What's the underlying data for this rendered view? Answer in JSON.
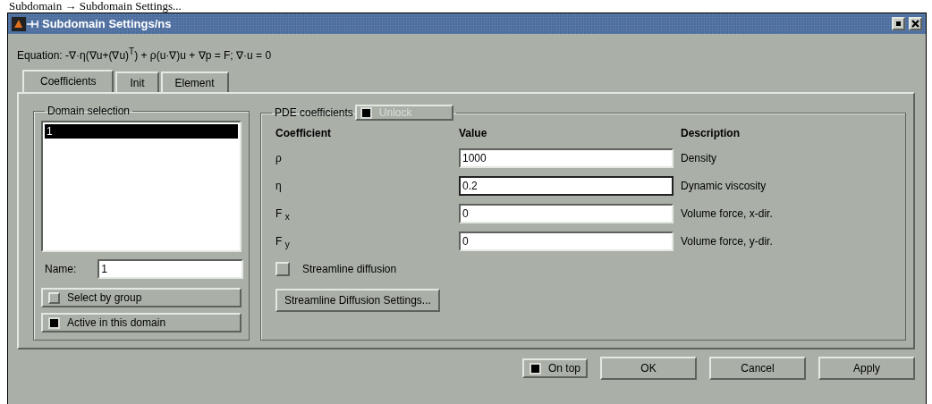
{
  "caption": "Subdomain → Subdomain Settings...",
  "window": {
    "title": "Subdomain Settings/ns"
  },
  "equation": "Equation: -∇·η(∇u+(∇u)$^{T}$) + ρ(u·∇)u + ∇p = F; ∇·u = 0",
  "tabs": [
    {
      "label": "Coefficients",
      "selected": true
    },
    {
      "label": "Init",
      "selected": false
    },
    {
      "label": "Element",
      "selected": false
    }
  ],
  "domain_selection": {
    "title": "Domain selection",
    "items": [
      {
        "label": "1",
        "selected": true
      }
    ],
    "name_label": "Name:",
    "name_value": "1",
    "toggles": [
      {
        "label": "Select by group",
        "checked": false
      },
      {
        "label": "Active in this domain",
        "checked": true
      }
    ]
  },
  "pde": {
    "title": "PDE coefficients",
    "unlock": {
      "label": "Unlock",
      "checked": true,
      "disabled": true
    },
    "columns": [
      "Coefficient",
      "Value",
      "Description"
    ],
    "rows": [
      {
        "coefficient": "ρ",
        "value": "1000",
        "description": "Density",
        "focused": false
      },
      {
        "coefficient": "η",
        "value": "0.2",
        "description": "Dynamic viscosity",
        "focused": true
      },
      {
        "coefficient": "F $_{x}$",
        "value": "0",
        "description": "Volume force, x-dir.",
        "focused": false
      },
      {
        "coefficient": "F $_{y}$",
        "value": "0",
        "description": "Volume force, y-dir.",
        "focused": false
      }
    ],
    "streamline": {
      "label": "Streamline diffusion",
      "checked": false
    },
    "settings_button": "Streamline Diffusion Settings..."
  },
  "footer": {
    "on_top": {
      "label": "On top",
      "checked": true
    },
    "buttons": [
      "OK",
      "Cancel",
      "Apply"
    ]
  }
}
